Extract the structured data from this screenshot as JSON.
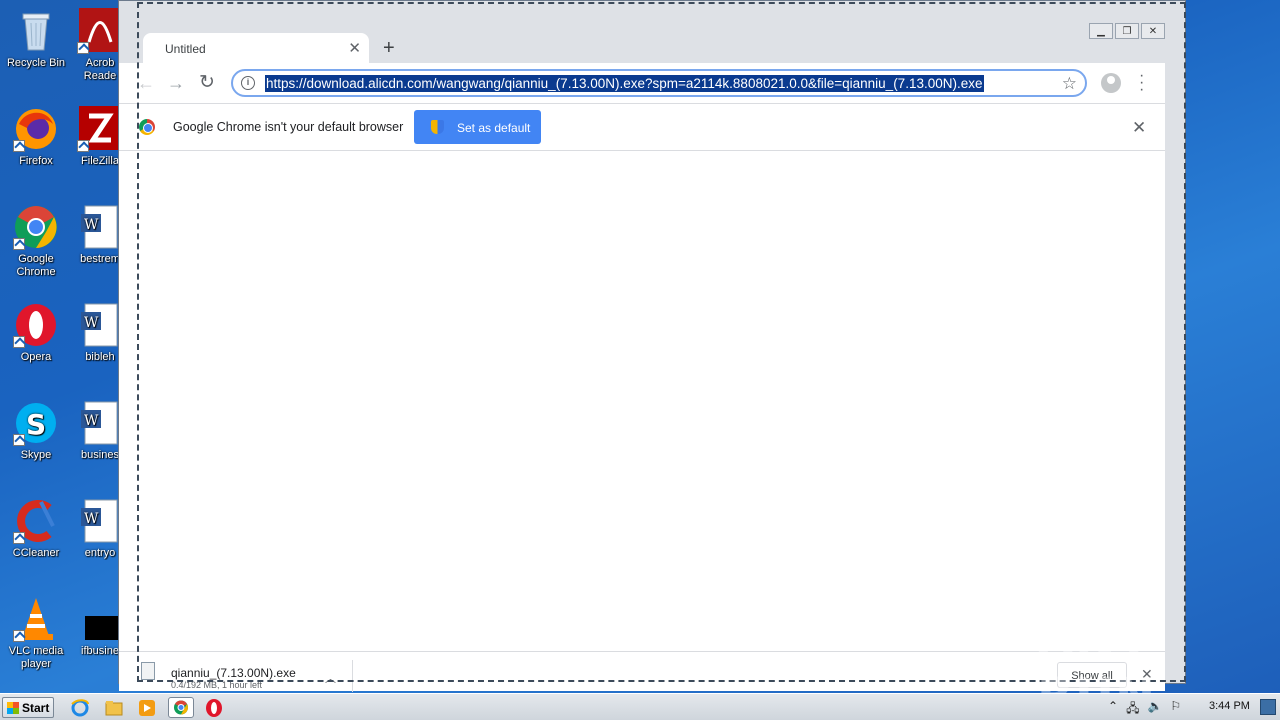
{
  "desktop": {
    "icons": [
      {
        "label": "Recycle Bin"
      },
      {
        "label": "Acrob Reade"
      },
      {
        "label": "Firefox"
      },
      {
        "label": "FileZilla"
      },
      {
        "label": "Google Chrome"
      },
      {
        "label": "bestrem"
      },
      {
        "label": "Opera"
      },
      {
        "label": "bibleh"
      },
      {
        "label": "Skype"
      },
      {
        "label": "busines"
      },
      {
        "label": "CCleaner"
      },
      {
        "label": "entryo"
      },
      {
        "label": "VLC media player"
      },
      {
        "label": "ifbusine"
      }
    ]
  },
  "browser": {
    "tab_title": "Untitled",
    "new_tab_symbol": "+",
    "url": "https://download.alicdn.com/wangwang/qianniu_(7.13.00N).exe?spm=a2114k.8808021.0.0&file=qianniu_(7.13.00N).exe",
    "info_icon_glyph": "i",
    "infobar_message": "Google Chrome isn't your default browser",
    "set_default_label": "Set as default",
    "download": {
      "filename": "qianniu_(7.13.00N).exe",
      "status": "0.4/192 MB, 1 hour left"
    },
    "show_all_label": "Show all"
  },
  "watermark": "ANY RUN",
  "taskbar": {
    "start_label": "Start",
    "clock": "3:44 PM"
  },
  "colors": {
    "accent": "#4285f4",
    "url_highlight": "#0a3a8f",
    "desktop_bg": "#1a63c0"
  }
}
